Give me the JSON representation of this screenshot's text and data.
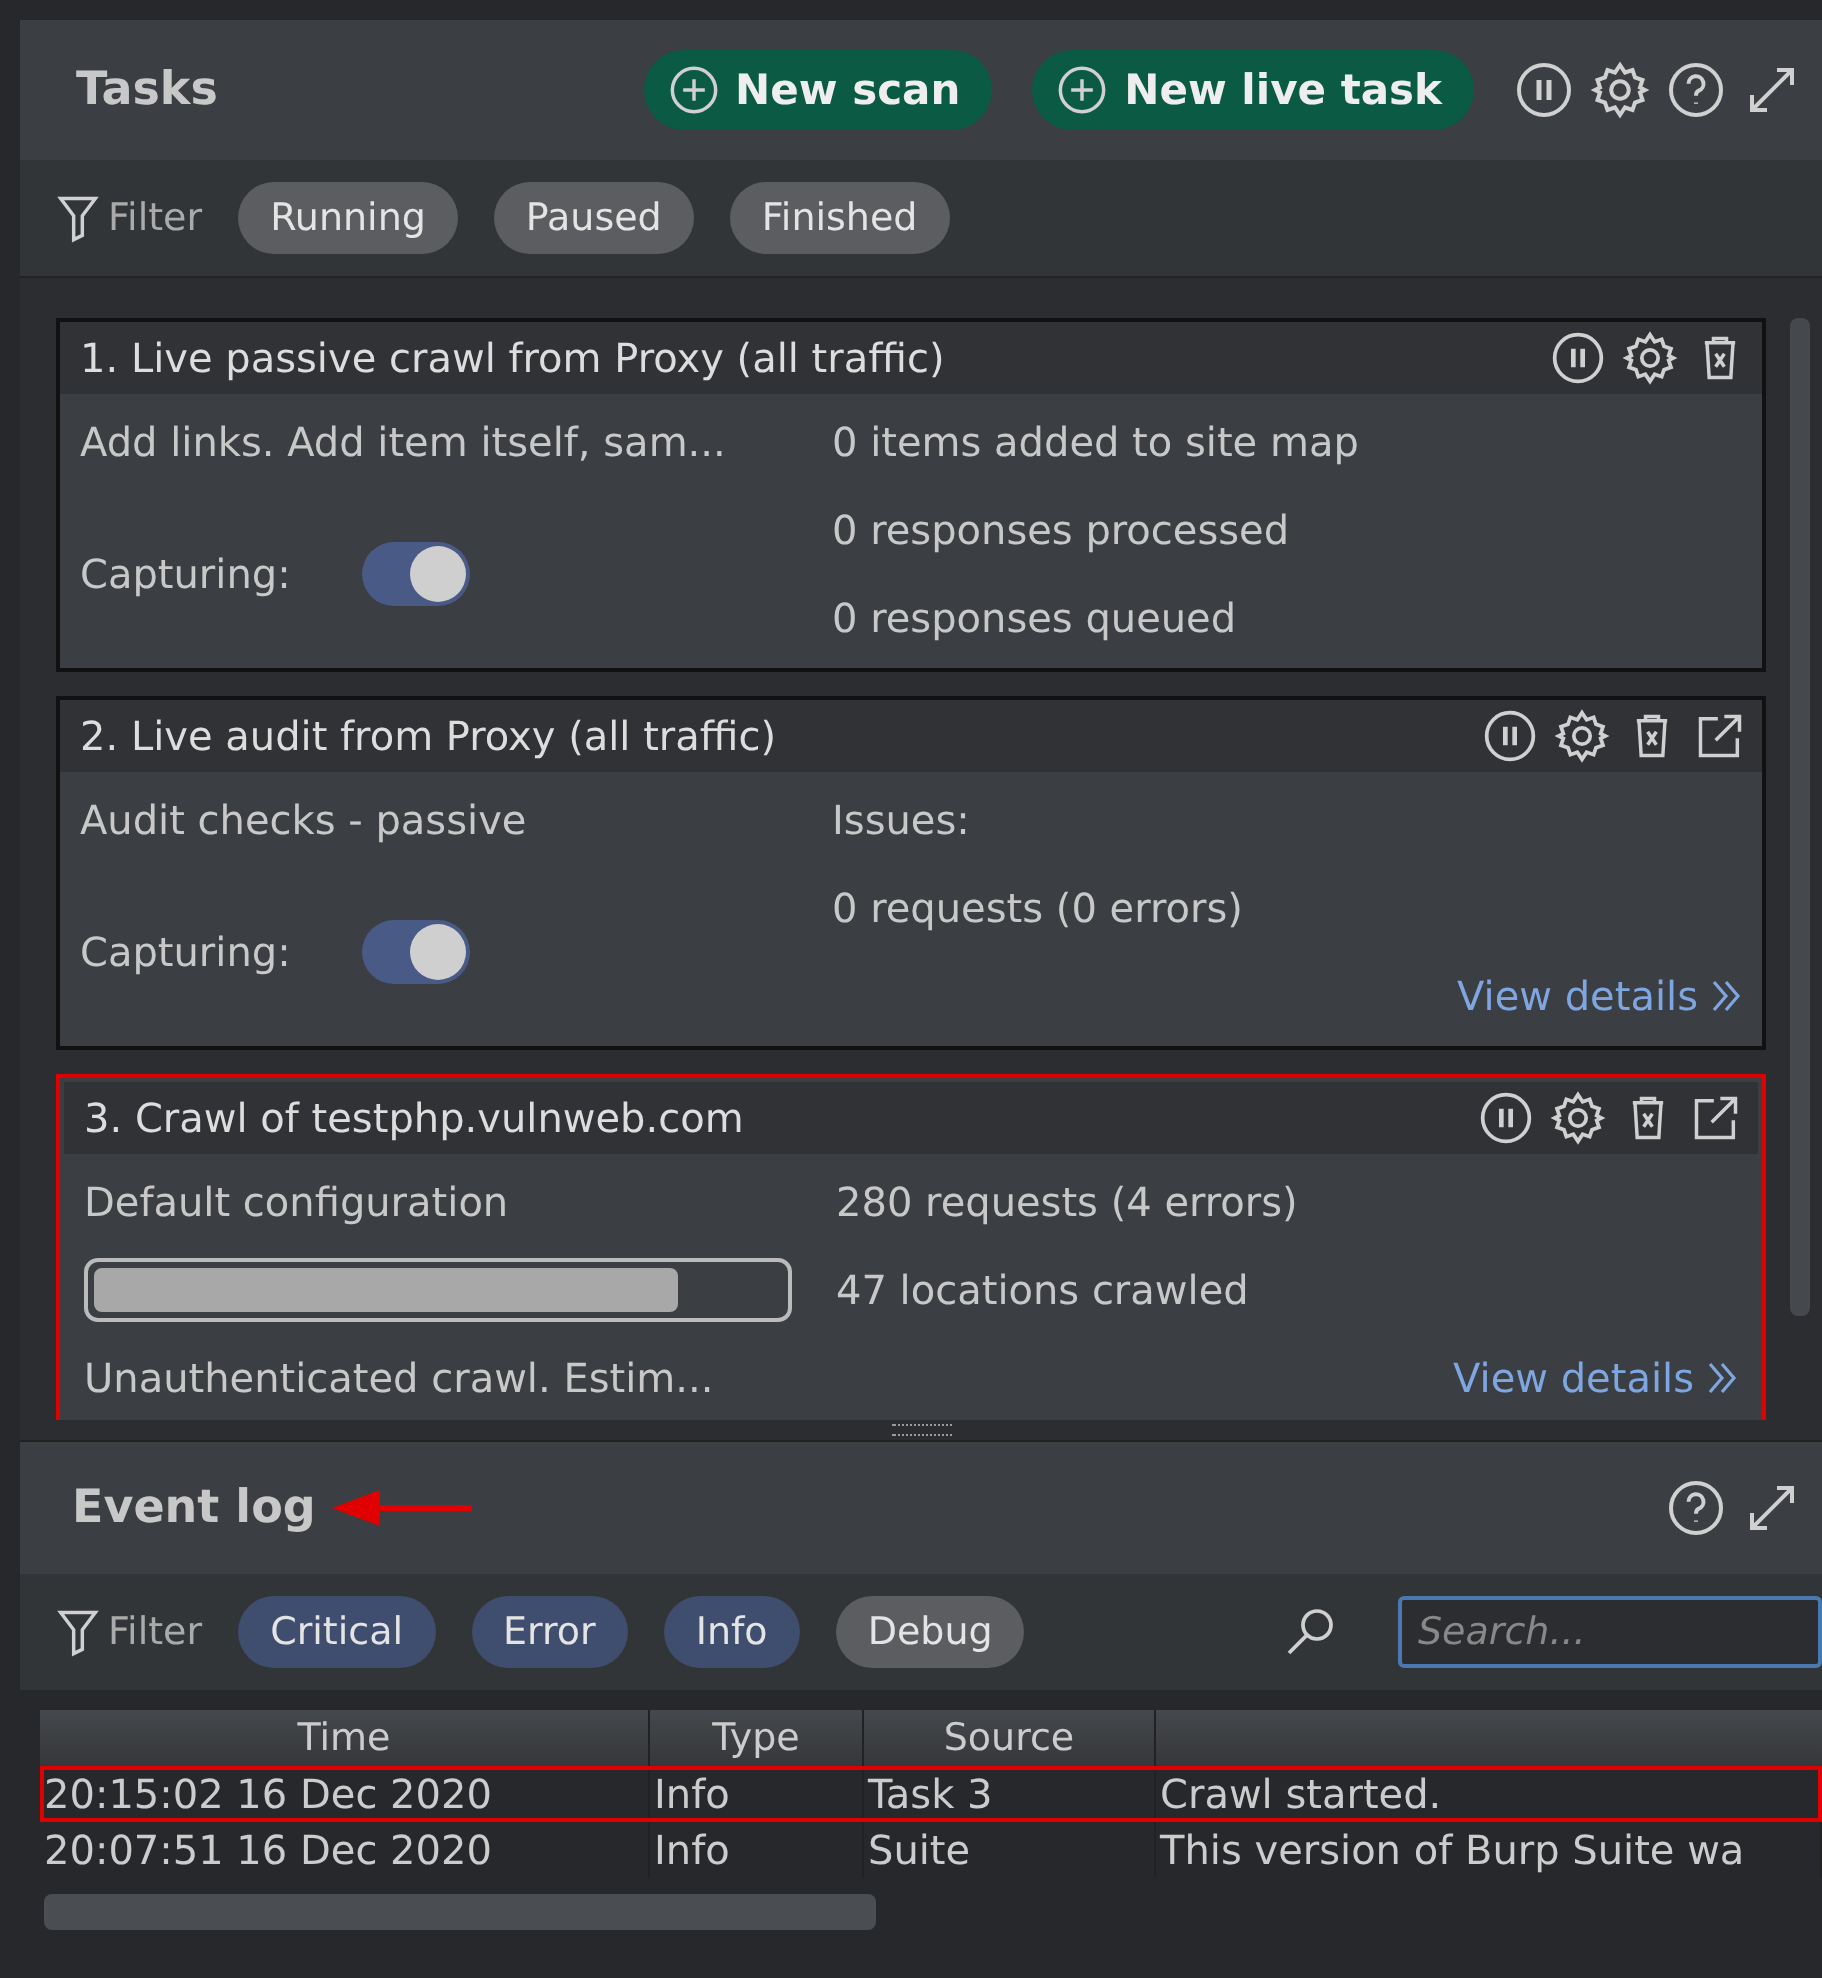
{
  "tasks_panel": {
    "title": "Tasks",
    "buttons": [
      "New scan",
      "New live task"
    ],
    "filter": {
      "label": "Filter",
      "chips": [
        {
          "label": "Running",
          "selected": false
        },
        {
          "label": "Paused",
          "selected": false
        },
        {
          "label": "Finished",
          "selected": false
        }
      ]
    }
  },
  "tasks": [
    {
      "title": "1. Live passive crawl from Proxy (all traffic)",
      "popout": false,
      "description": "Add links. Add item itself, sam...",
      "kind": "toggle",
      "capture_label": "Capturing:",
      "capturing": true,
      "stats": [
        "0 items added to site map",
        "0 responses processed",
        "0 responses queued"
      ],
      "highlighted": false
    },
    {
      "title": "2. Live audit from Proxy (all traffic)",
      "popout": true,
      "description": "Audit checks - passive",
      "kind": "toggle",
      "capture_label": "Capturing:",
      "capturing": true,
      "stats": [
        "Issues:",
        "0 requests (0 errors)"
      ],
      "link": "View details",
      "highlighted": false
    },
    {
      "title": "3. Crawl of testphp.vulnweb.com",
      "popout": true,
      "description": "Default configuration",
      "kind": "progress",
      "level": 0.85,
      "note": "Unauthenticated crawl. Estim...",
      "stats": [
        "280 requests (4 errors)",
        "47 locations crawled"
      ],
      "link": "View details",
      "highlighted": true
    }
  ],
  "event_log": {
    "title": "Event log",
    "arrow": true,
    "filter": {
      "label": "Filter",
      "chips": [
        {
          "label": "Critical",
          "selected": true
        },
        {
          "label": "Error",
          "selected": true
        },
        {
          "label": "Info",
          "selected": true
        },
        {
          "label": "Debug",
          "selected": false
        }
      ]
    },
    "search": {
      "placeholder": "Search..."
    },
    "columns": [
      "Time",
      "Type",
      "Source"
    ],
    "rows": [
      {
        "cells": [
          "20:15:02 16 Dec 2020",
          "Info",
          "Task 3",
          "Crawl started."
        ],
        "highlighted": true
      },
      {
        "cells": [
          "20:07:51 16 Dec 2020",
          "Info",
          "Suite",
          "This version of Burp Suite wa"
        ],
        "highlighted": false
      }
    ]
  }
}
